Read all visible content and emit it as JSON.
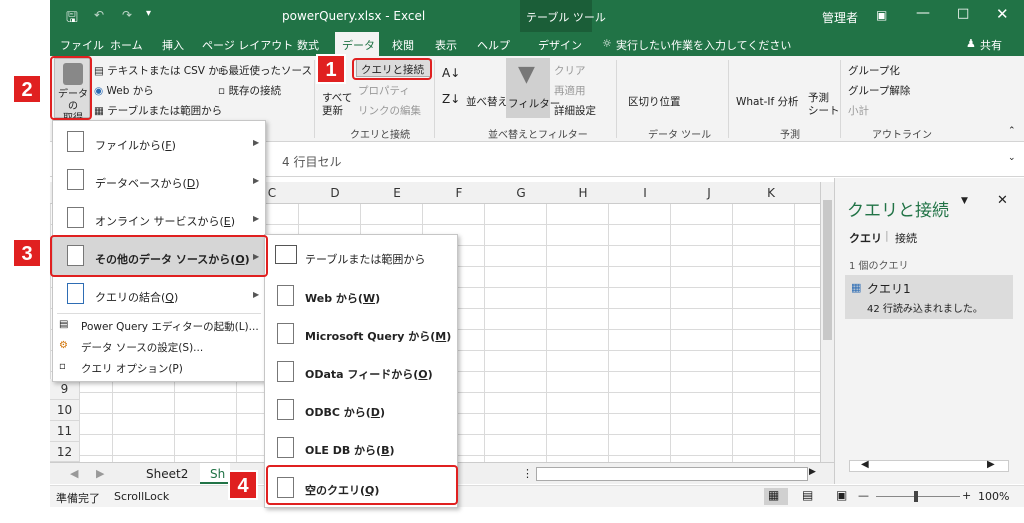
{
  "title": {
    "filename": "powerQuery.xlsx  -  Excel",
    "context_group": "テーブル ツール",
    "user": "管理者"
  },
  "tabs": [
    "ファイル",
    "ホーム",
    "挿入",
    "ページ レイアウト",
    "数式",
    "データ",
    "校閲",
    "表示",
    "ヘルプ",
    "デザイン"
  ],
  "tell_me": "実行したい作業を入力してください",
  "share": "共有",
  "ribbon": {
    "get_data": "データの\n取得",
    "from_text_csv": "テキストまたは CSV から",
    "from_web": "Web から",
    "from_table": "テーブルまたは範囲から",
    "recent_sources": "最近使ったソース",
    "existing_conn": "既存の接続",
    "refresh_all": "すべて\n更新",
    "queries_conn": "クエリと接続",
    "properties": "プロパティ",
    "edit_links": "リンクの編集",
    "group_queries": "クエリと接続",
    "sort": "並べ替え",
    "filter": "フィルター",
    "clear": "クリア",
    "reapply": "再適用",
    "advanced": "詳細設定",
    "group_sort": "並べ替えとフィルター",
    "text_to_cols": "区切り位置",
    "group_tools": "データ ツール",
    "whatif": "What-If 分析",
    "forecast": "予測\nシート",
    "group_forecast": "予測",
    "group": "グループ化",
    "ungroup": "グループ解除",
    "subtotal": "小計",
    "group_outline": "アウトライン"
  },
  "formula_bar": "4 行目セル",
  "columns": [
    "C",
    "D",
    "E",
    "F",
    "G",
    "H",
    "I",
    "J",
    "K"
  ],
  "rows": [
    "9",
    "10",
    "11",
    "12"
  ],
  "sheets": [
    "Sheet2",
    "Sh"
  ],
  "status": {
    "ready": "準備完了",
    "scroll": "ScrollLock",
    "zoom": "100%"
  },
  "menu1": [
    {
      "label": "ファイルから(",
      "key": "F",
      "end": ")"
    },
    {
      "label": "データベースから(",
      "key": "D",
      "end": ")"
    },
    {
      "label": "オンライン サービスから(",
      "key": "E",
      "end": ")"
    },
    {
      "label": "その他のデータ ソースから(",
      "key": "O",
      "end": ")"
    },
    {
      "label": "クエリの結合(",
      "key": "Q",
      "end": ")"
    }
  ],
  "menu1_small": [
    "Power Query エディターの起動(L)...",
    "データ ソースの設定(S)...",
    "クエリ オプション(P)"
  ],
  "menu2": [
    {
      "label": "テーブルまたは範囲から",
      "key": "",
      "end": ""
    },
    {
      "label": "Web から(",
      "key": "W",
      "end": ")"
    },
    {
      "label": "Microsoft Query から(",
      "key": "M",
      "end": ")"
    },
    {
      "label": "OData フィードから(",
      "key": "O",
      "end": ")"
    },
    {
      "label": "ODBC から(",
      "key": "D",
      "end": ")"
    },
    {
      "label": "OLE DB から(",
      "key": "B",
      "end": ")"
    },
    {
      "label": "空のクエリ(",
      "key": "Q",
      "end": ")"
    }
  ],
  "pane": {
    "title": "クエリと接続",
    "tab1": "クエリ",
    "tab2": "接続",
    "count": "1 個のクエリ",
    "query": "クエリ1",
    "query_status": "42 行読み込まれました。"
  },
  "badges": [
    "1",
    "2",
    "3",
    "4"
  ],
  "colors": {
    "excel_green": "#217346",
    "highlight_red": "#e02020"
  }
}
